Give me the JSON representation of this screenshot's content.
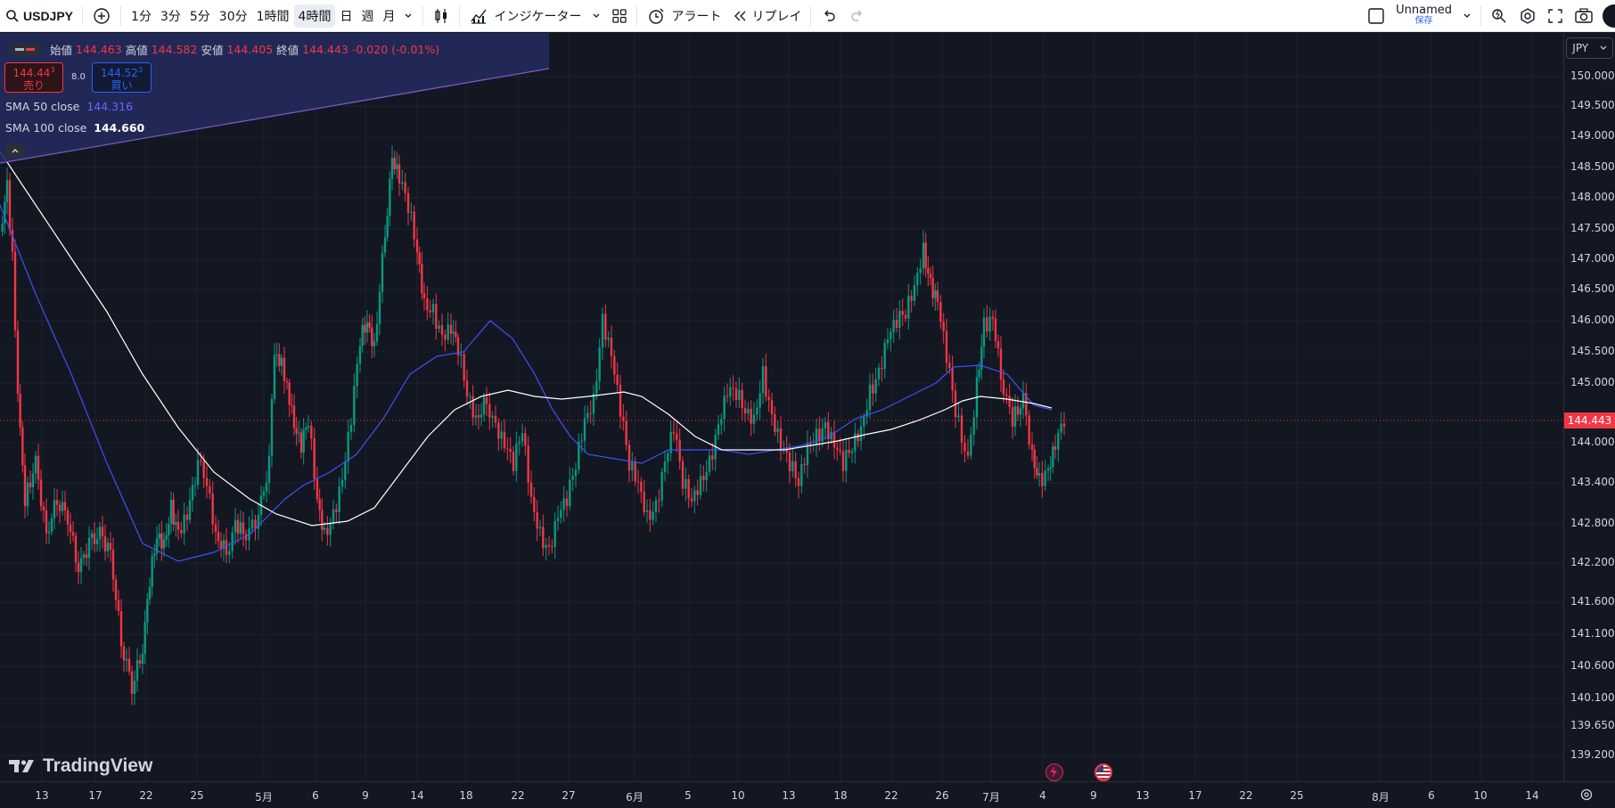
{
  "toolbar": {
    "symbol": "USDJPY",
    "timeframes": [
      "1分",
      "3分",
      "5分",
      "30分",
      "1時間",
      "4時間",
      "日",
      "週",
      "月"
    ],
    "active_timeframe": "4時間",
    "indicators_label": "インジケーター",
    "alert_label": "アラート",
    "replay_label": "リプレイ",
    "layout_name": "Unnamed",
    "layout_status": "保存"
  },
  "legend": {
    "open_label": "始値",
    "open": "144.463",
    "high_label": "高値",
    "high": "144.582",
    "low_label": "安値",
    "low": "144.405",
    "close_label": "終値",
    "close": "144.443",
    "change": "-0.020 (-0.01%)",
    "sell_price": "144.44",
    "sell_price_sup": "3",
    "sell_label": "売り",
    "spread": "8.0",
    "buy_price": "144.52",
    "buy_price_sup": "3",
    "buy_label": "買い",
    "sma50_label": "SMA 50 close",
    "sma50_value": "144.316",
    "sma100_label": "SMA 100 close",
    "sma100_value": "144.660"
  },
  "price_scale": {
    "currency": "JPY",
    "current_price": "144.443",
    "labels": [
      "150.000",
      "149.500",
      "149.000",
      "148.500",
      "148.000",
      "147.500",
      "147.000",
      "146.500",
      "146.000",
      "145.500",
      "145.000",
      "144.000",
      "143.400",
      "142.800",
      "142.200",
      "141.600",
      "141.100",
      "140.600",
      "140.100",
      "139.650",
      "139.200"
    ]
  },
  "time_scale": {
    "labels": [
      "13",
      "17",
      "22",
      "25",
      "5月",
      "6",
      "9",
      "14",
      "18",
      "22",
      "27",
      "6月",
      "5",
      "10",
      "13",
      "18",
      "22",
      "26",
      "7月",
      "4",
      "9",
      "13",
      "17",
      "22",
      "25",
      "8月",
      "6",
      "10",
      "14"
    ]
  },
  "watermark": "TradingView",
  "colors": {
    "up": "#089981",
    "down": "#f23645",
    "sma50": "#3f51f5",
    "sma100": "#ffffff",
    "background": "#131722"
  }
}
